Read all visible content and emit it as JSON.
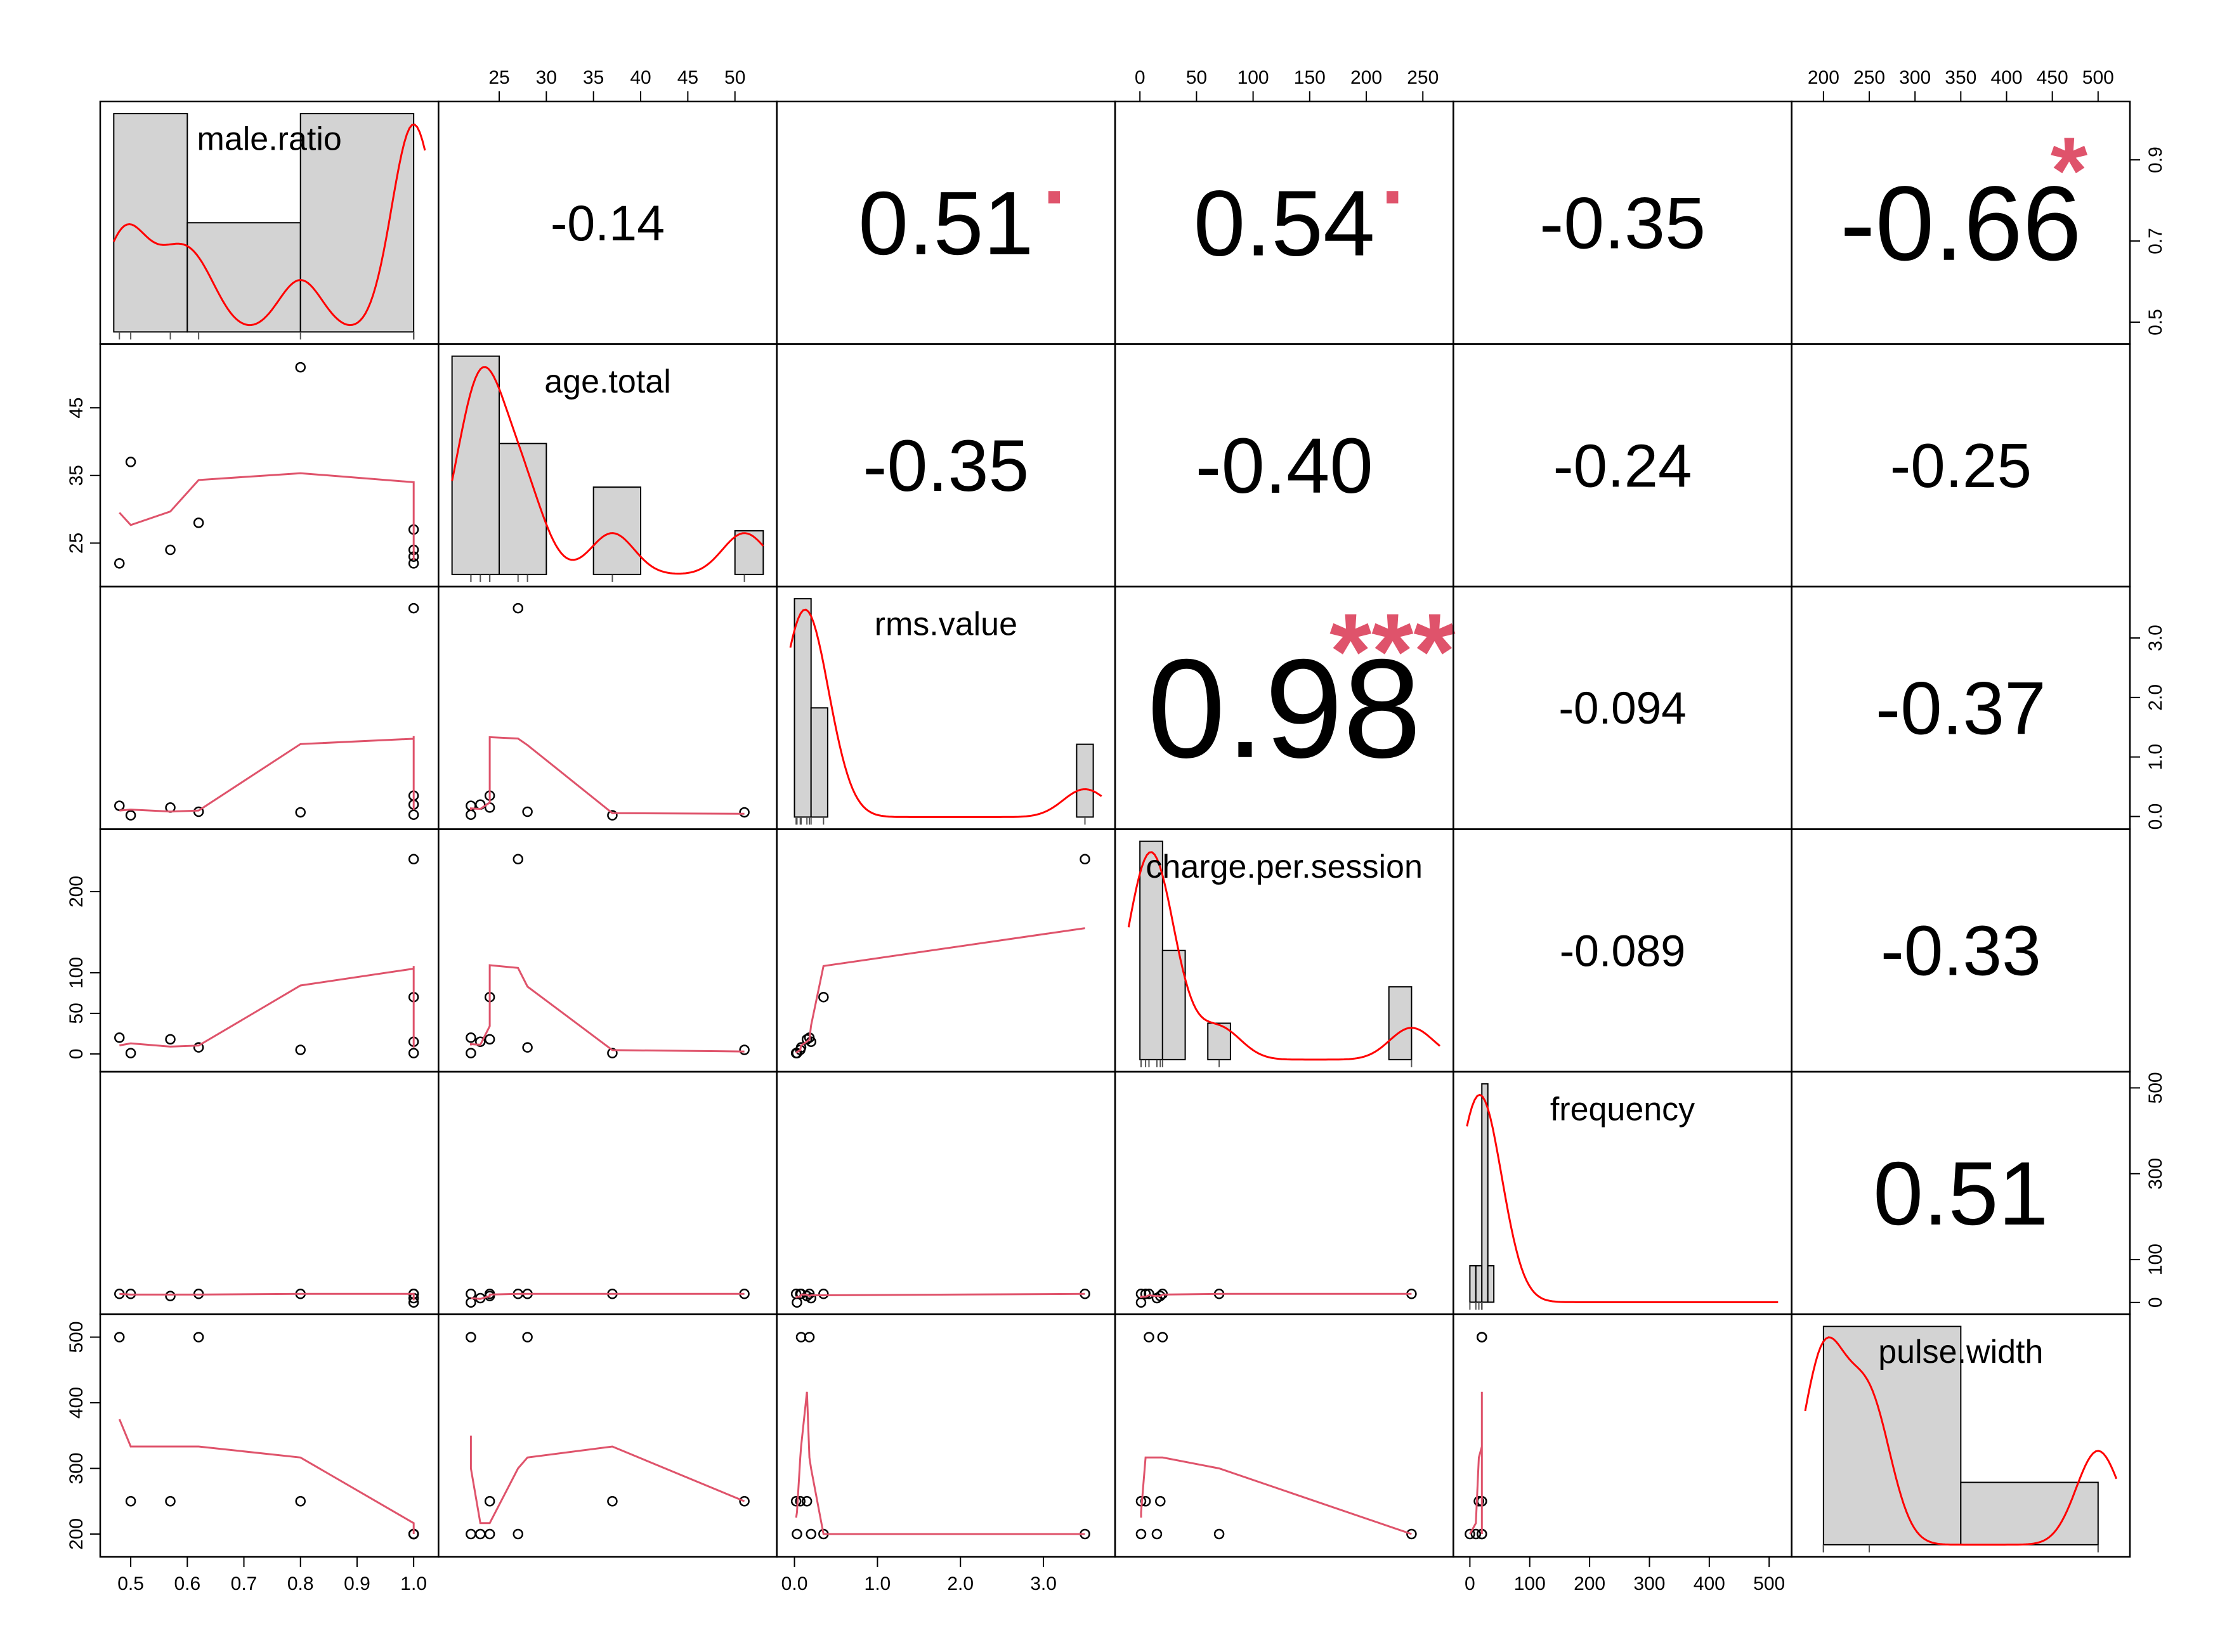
{
  "chart_data": {
    "type": "scatter",
    "title": "",
    "variables": [
      "male.ratio",
      "age.total",
      "rms.value",
      "charge.per.session",
      "frequency",
      "pulse.width"
    ],
    "observations": {
      "male.ratio": [
        0.48,
        0.5,
        0.57,
        0.62,
        0.8,
        1.0,
        1.0,
        1.0,
        1.0
      ],
      "age.total": [
        22,
        37,
        24,
        28,
        51,
        27,
        24,
        23,
        22
      ],
      "rms.value": [
        0.18,
        0.02,
        0.15,
        0.08,
        0.07,
        3.5,
        0.35,
        0.2,
        0.03
      ],
      "charge.per.session": [
        20,
        1,
        18,
        8,
        5,
        240,
        70,
        15,
        1
      ],
      "frequency": [
        20,
        20,
        15,
        20,
        20,
        20,
        20,
        10,
        0
      ],
      "pulse.width": [
        500,
        250,
        250,
        500,
        250,
        200,
        200,
        200,
        200
      ]
    },
    "correlations": [
      {
        "pair": [
          "male.ratio",
          "age.total"
        ],
        "label": "-0.14",
        "stars": ""
      },
      {
        "pair": [
          "male.ratio",
          "rms.value"
        ],
        "label": "0.51",
        "stars": "."
      },
      {
        "pair": [
          "male.ratio",
          "charge.per.session"
        ],
        "label": "0.54",
        "stars": "."
      },
      {
        "pair": [
          "male.ratio",
          "frequency"
        ],
        "label": "-0.35",
        "stars": ""
      },
      {
        "pair": [
          "male.ratio",
          "pulse.width"
        ],
        "label": "-0.66",
        "stars": "*"
      },
      {
        "pair": [
          "age.total",
          "rms.value"
        ],
        "label": "-0.35",
        "stars": ""
      },
      {
        "pair": [
          "age.total",
          "charge.per.session"
        ],
        "label": "-0.40",
        "stars": ""
      },
      {
        "pair": [
          "age.total",
          "frequency"
        ],
        "label": "-0.24",
        "stars": ""
      },
      {
        "pair": [
          "age.total",
          "pulse.width"
        ],
        "label": "-0.25",
        "stars": ""
      },
      {
        "pair": [
          "rms.value",
          "charge.per.session"
        ],
        "label": "0.98",
        "stars": "***"
      },
      {
        "pair": [
          "rms.value",
          "frequency"
        ],
        "label": "-0.094",
        "stars": ""
      },
      {
        "pair": [
          "rms.value",
          "pulse.width"
        ],
        "label": "-0.37",
        "stars": ""
      },
      {
        "pair": [
          "charge.per.session",
          "frequency"
        ],
        "label": "-0.089",
        "stars": ""
      },
      {
        "pair": [
          "charge.per.session",
          "pulse.width"
        ],
        "label": "-0.33",
        "stars": ""
      },
      {
        "pair": [
          "frequency",
          "pulse.width"
        ],
        "label": "0.51",
        "stars": ""
      }
    ],
    "ranges": {
      "male.ratio": [
        0.47,
        1.02
      ],
      "age.total": [
        20,
        53
      ],
      "rms.value": [
        -0.05,
        3.7
      ],
      "charge.per.session": [
        -10,
        265
      ],
      "frequency": [
        -5,
        515
      ],
      "pulse.width": [
        180,
        520
      ]
    },
    "ticks": {
      "male.ratio": [
        0.5,
        0.6,
        0.7,
        0.8,
        0.9,
        1.0
      ],
      "age.total_top": [
        25,
        30,
        35,
        40,
        45,
        50
      ],
      "age.total_left": [
        25,
        35,
        45
      ],
      "rms.value": [
        0.0,
        1.0,
        2.0,
        3.0
      ],
      "charge.per.session_top": [
        0,
        50,
        100,
        150,
        200,
        250
      ],
      "charge.per.session_left": [
        0,
        50,
        100,
        200
      ],
      "frequency": [
        0,
        100,
        200,
        300,
        400,
        500
      ],
      "frequency_right": [
        0,
        100,
        300,
        500
      ],
      "pulse.width_top": [
        200,
        250,
        300,
        350,
        400,
        450,
        500
      ],
      "pulse.width_left": [
        200,
        300,
        400,
        500
      ],
      "male.ratio_right": [
        0.5,
        0.7,
        0.9
      ]
    },
    "tick_labels": {
      "male.ratio": [
        "0.5",
        "0.6",
        "0.7",
        "0.8",
        "0.9",
        "1.0"
      ],
      "male.ratio_right": [
        "0.5",
        "0.7",
        "0.9"
      ],
      "age.total_top": [
        "25",
        "30",
        "35",
        "40",
        "45",
        "50"
      ],
      "age.total_left": [
        "25",
        "35",
        "45"
      ],
      "rms.value": [
        "0.0",
        "1.0",
        "2.0",
        "3.0"
      ],
      "charge.per.session_top": [
        "0",
        "50",
        "100",
        "150",
        "200",
        "250"
      ],
      "charge.per.session_left": [
        "0",
        "50",
        "100",
        "200"
      ],
      "frequency": [
        "0",
        "100",
        "200",
        "300",
        "400",
        "500"
      ],
      "frequency_right": [
        "0",
        "100",
        "300",
        "500"
      ],
      "pulse.width_top": [
        "200",
        "250",
        "300",
        "350",
        "400",
        "450",
        "500"
      ],
      "pulse.width_left": [
        "200",
        "300",
        "400",
        "500"
      ]
    },
    "histograms": {
      "male.ratio": {
        "breaks": [
          0.4,
          0.6,
          0.8,
          1.0
        ],
        "counts": [
          4,
          2,
          4
        ]
      },
      "age.total": {
        "breaks": [
          20,
          25,
          30,
          35,
          40,
          45,
          50,
          55
        ],
        "counts": [
          5,
          3,
          0,
          2,
          0,
          0,
          1
        ]
      },
      "rms.value": {
        "breaks": [
          0.0,
          0.2,
          0.4,
          0.6,
          0.8,
          1.0,
          1.2,
          1.4,
          1.6,
          1.8,
          2.0,
          2.2,
          2.4,
          2.6,
          2.8,
          3.0,
          3.2,
          3.4,
          3.6
        ],
        "counts": [
          6,
          3,
          0,
          0,
          0,
          0,
          0,
          0,
          0,
          0,
          0,
          0,
          0,
          0,
          0,
          0,
          0,
          2
        ]
      },
      "charge.per.session": {
        "breaks": [
          0,
          20,
          40,
          60,
          80,
          100,
          120,
          140,
          160,
          180,
          200,
          220,
          240
        ],
        "counts": [
          6,
          3,
          0,
          1,
          0,
          0,
          0,
          0,
          0,
          0,
          0,
          2
        ]
      },
      "frequency": {
        "breaks": [
          0,
          10,
          20,
          30,
          40,
          500
        ],
        "counts": [
          1,
          1,
          6,
          1,
          0
        ]
      },
      "pulse.width": {
        "breaks": [
          200,
          350,
          500
        ],
        "counts": [
          7,
          2
        ]
      }
    },
    "star_color": "#df536b",
    "fit_color": "#df536b",
    "density_color": "#ff0000",
    "hist_fill": "#d3d3d3",
    "grid": false
  }
}
